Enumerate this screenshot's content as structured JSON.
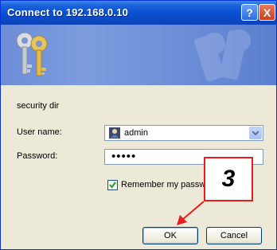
{
  "window": {
    "title": "Connect to 192.168.0.10",
    "help_glyph": "?",
    "close_glyph": "X"
  },
  "banner": {
    "icon": "keys-icon"
  },
  "form": {
    "realm": "security dir",
    "username_label": "User name:",
    "username_value": "admin",
    "password_label": "Password:",
    "password_value": "•••••",
    "remember_label": "Remember my passw",
    "remember_checked": true
  },
  "buttons": {
    "ok": "OK",
    "cancel": "Cancel"
  },
  "annotation": {
    "step": "3",
    "color": "#e81d1d"
  },
  "colors": {
    "titlebar": "#0a53d6",
    "dialog_bg": "#ece9d8",
    "banner": "#6c8dd6"
  }
}
